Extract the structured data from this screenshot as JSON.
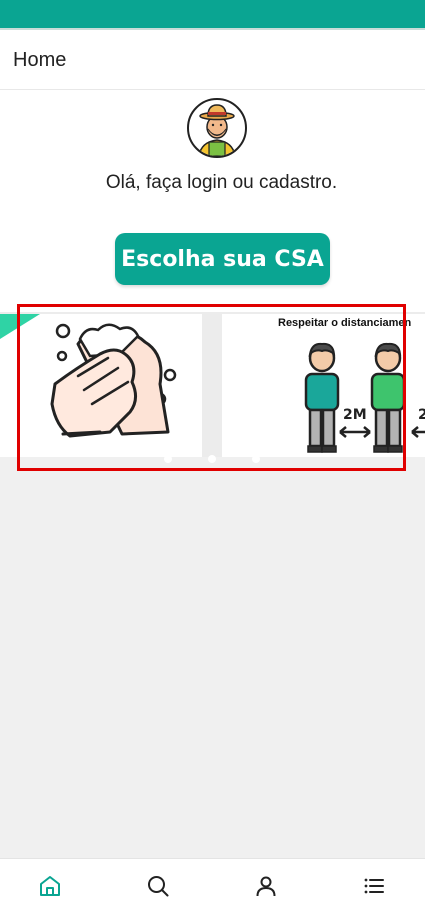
{
  "header": {
    "title": "Home"
  },
  "welcome": {
    "greeting": "Olá, faça login ou cadastro.",
    "cta_label": "Escolha sua CSA"
  },
  "carousel": {
    "slides": [
      {
        "icon": "hand-washing-icon",
        "title": ""
      },
      {
        "icon": "social-distancing-icon",
        "title": "Respeitar o distanciamen",
        "distance_label": "2M"
      }
    ]
  },
  "bottom_nav": {
    "items": [
      {
        "icon": "home-icon",
        "active": true
      },
      {
        "icon": "search-icon"
      },
      {
        "icon": "user-icon"
      },
      {
        "icon": "menu-list-icon"
      }
    ]
  },
  "colors": {
    "primary": "#0aa592",
    "highlight": "#e00000",
    "icon_active": "#0aa592",
    "icon_inactive": "#222222"
  }
}
